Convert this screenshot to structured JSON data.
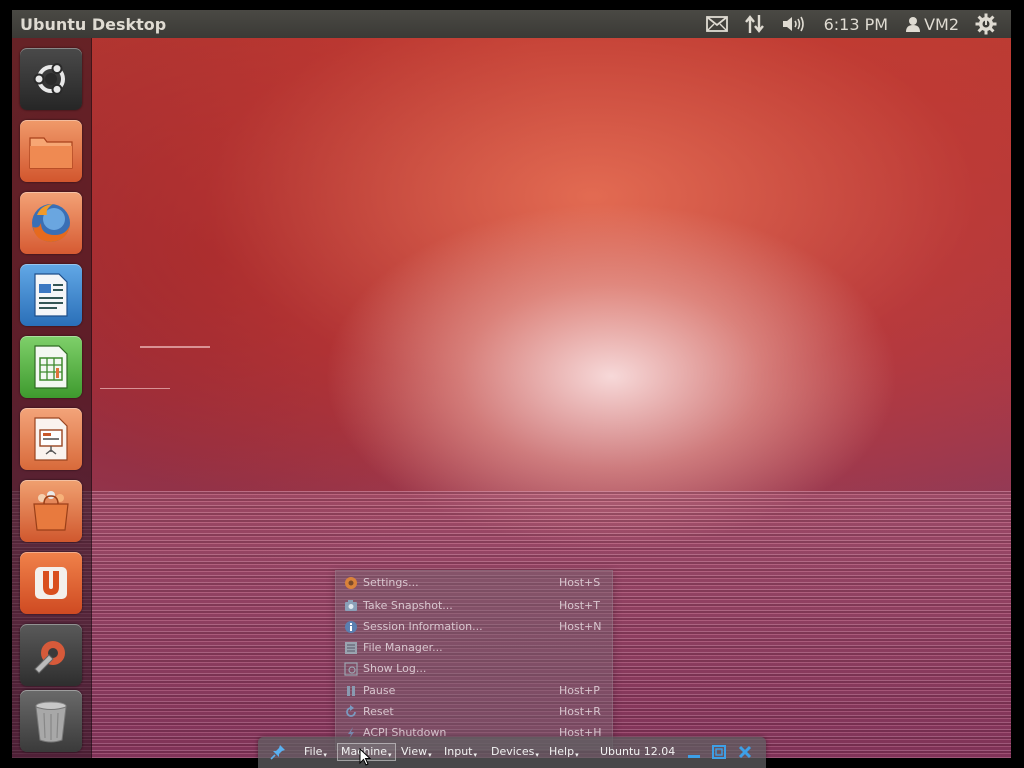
{
  "top_panel": {
    "app_title": "Ubuntu Desktop",
    "clock": "6:13 PM",
    "user": "VM2",
    "indicators": [
      "mail-icon",
      "network-arrows-icon",
      "volume-icon",
      "user-icon",
      "session-gear-icon"
    ]
  },
  "launcher": {
    "items": [
      {
        "name": "dash-home",
        "icon": "ubuntu-logo-icon"
      },
      {
        "name": "files",
        "icon": "folder-icon"
      },
      {
        "name": "firefox",
        "icon": "firefox-icon"
      },
      {
        "name": "libreoffice-writer",
        "icon": "writer-document-icon"
      },
      {
        "name": "libreoffice-calc",
        "icon": "calc-spreadsheet-icon"
      },
      {
        "name": "libreoffice-impress",
        "icon": "impress-presentation-icon"
      },
      {
        "name": "software-center",
        "icon": "shopping-bag-icon"
      },
      {
        "name": "ubuntu-one",
        "icon": "ubuntu-one-icon"
      },
      {
        "name": "system-settings",
        "icon": "settings-wrench-icon"
      },
      {
        "name": "trash",
        "icon": "trash-icon"
      }
    ]
  },
  "machine_menu": {
    "items": [
      {
        "label": "Settings...",
        "shortcut": "Host+S",
        "icon": "settings-icon"
      },
      {
        "label": "Take Snapshot...",
        "shortcut": "Host+T",
        "icon": "snapshot-icon"
      },
      {
        "label": "Session Information...",
        "shortcut": "Host+N",
        "icon": "info-icon"
      },
      {
        "label": "File Manager...",
        "shortcut": "",
        "icon": "file-manager-icon"
      },
      {
        "label": "Show Log...",
        "shortcut": "",
        "icon": "log-icon"
      },
      {
        "label": "Pause",
        "shortcut": "Host+P",
        "icon": "pause-icon"
      },
      {
        "label": "Reset",
        "shortcut": "Host+R",
        "icon": "reset-icon"
      },
      {
        "label": "ACPI Shutdown",
        "shortcut": "Host+H",
        "icon": "shutdown-icon"
      }
    ]
  },
  "vbox_toolbar": {
    "menus": [
      "File",
      "Machine",
      "View",
      "Input",
      "Devices",
      "Help"
    ],
    "vm_name": "Ubuntu 12.04",
    "buttons": [
      "pin-icon",
      "minimize-icon",
      "restore-icon",
      "close-icon"
    ]
  },
  "colors": {
    "panel_bg": "#3b3a36",
    "panel_text": "#dfdbd2",
    "wallpaper_primary": "#b83c33",
    "close_button": "#3da0e8"
  }
}
